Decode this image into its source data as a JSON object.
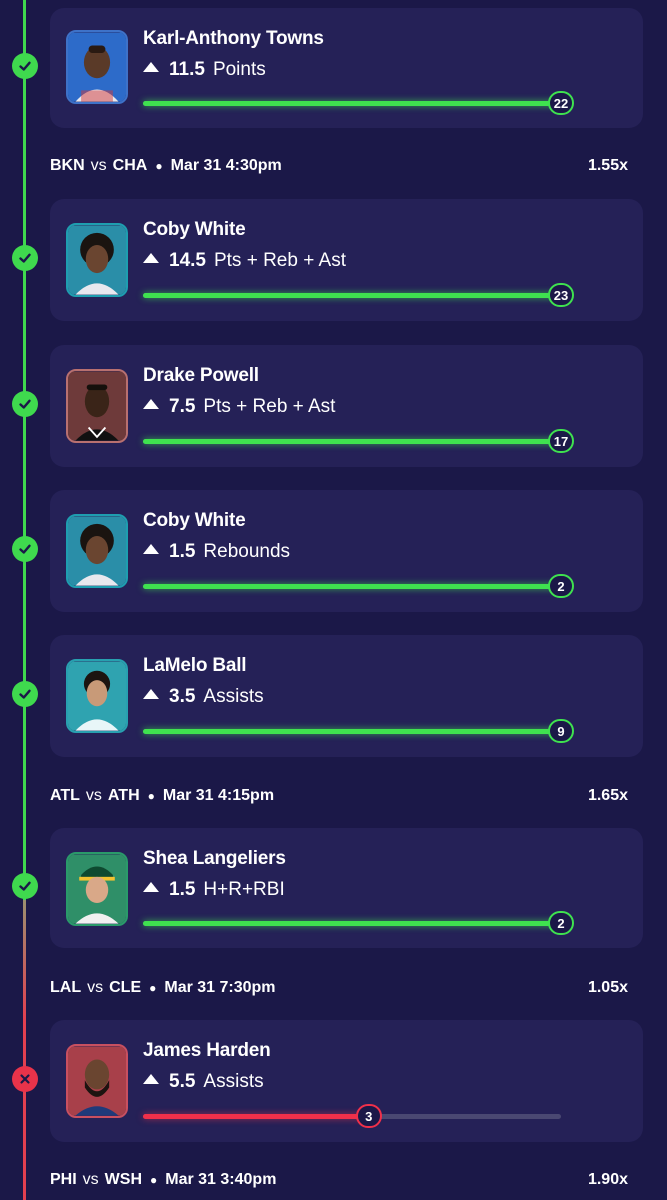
{
  "colors": {
    "background": "#1b1848",
    "card": "#252157",
    "success": "#3fe24f",
    "fail": "#f0304a",
    "track": "#4a4872"
  },
  "picks": [
    {
      "player": "Karl-Anthony Towns",
      "line": "11.5",
      "stat": "Points",
      "actual": "22",
      "progress_pct": 100,
      "result": "hit",
      "result_icon": "check-icon",
      "avatar": "player-headshot"
    },
    {
      "player": "Coby White",
      "line": "14.5",
      "stat": "Pts + Reb + Ast",
      "actual": "23",
      "progress_pct": 100,
      "result": "hit",
      "result_icon": "check-icon",
      "avatar": "player-headshot"
    },
    {
      "player": "Drake Powell",
      "line": "7.5",
      "stat": "Pts + Reb + Ast",
      "actual": "17",
      "progress_pct": 100,
      "result": "hit",
      "result_icon": "check-icon",
      "avatar": "player-headshot"
    },
    {
      "player": "Coby White",
      "line": "1.5",
      "stat": "Rebounds",
      "actual": "2",
      "progress_pct": 100,
      "result": "hit",
      "result_icon": "check-icon",
      "avatar": "player-headshot"
    },
    {
      "player": "LaMelo Ball",
      "line": "3.5",
      "stat": "Assists",
      "actual": "9",
      "progress_pct": 100,
      "result": "hit",
      "result_icon": "check-icon",
      "avatar": "player-headshot"
    },
    {
      "player": "Shea Langeliers",
      "line": "1.5",
      "stat": "H+R+RBI",
      "actual": "2",
      "progress_pct": 100,
      "result": "hit",
      "result_icon": "check-icon",
      "avatar": "player-headshot"
    },
    {
      "player": "James Harden",
      "line": "5.5",
      "stat": "Assists",
      "actual": "3",
      "progress_pct": 54,
      "result": "miss",
      "result_icon": "x-icon",
      "avatar": "player-headshot"
    }
  ],
  "matchups": [
    {
      "home": "BKN",
      "vs": "vs",
      "away": "CHA",
      "time": "Mar 31 4:30pm",
      "multiplier": "1.55x"
    },
    {
      "home": "ATL",
      "vs": "vs",
      "away": "ATH",
      "time": "Mar 31 4:15pm",
      "multiplier": "1.65x"
    },
    {
      "home": "LAL",
      "vs": "vs",
      "away": "CLE",
      "time": "Mar 31 7:30pm",
      "multiplier": "1.05x"
    },
    {
      "home": "PHI",
      "vs": "vs",
      "away": "WSH",
      "time": "Mar 31 3:40pm",
      "multiplier": "1.90x"
    }
  ]
}
